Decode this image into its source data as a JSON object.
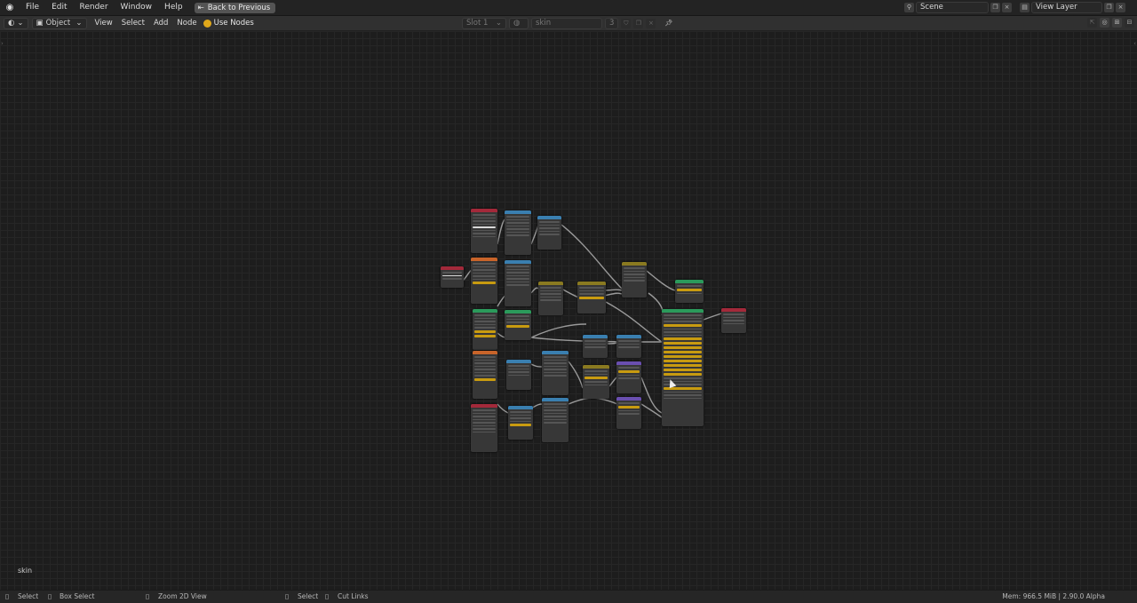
{
  "topbar": {
    "menus": [
      "File",
      "Edit",
      "Render",
      "Window",
      "Help"
    ],
    "back_label": "Back to Previous",
    "scene": "Scene",
    "view_layer": "View Layer"
  },
  "editor_header": {
    "object_mode": "Object",
    "menus": [
      "View",
      "Select",
      "Add",
      "Node"
    ],
    "use_nodes": "Use Nodes",
    "slot": "Slot 1",
    "material": "skin",
    "users": "3"
  },
  "canvas": {
    "material_label": "skin"
  },
  "statusbar": {
    "select": "Select",
    "box_select": "Box Select",
    "zoom": "Zoom 2D View",
    "select2": "Select",
    "cut_links": "Cut Links",
    "mem": "Mem: 966.5 MiB | 2.90.0 Alpha"
  },
  "colors": {
    "input": "#a3293a",
    "converter": "#3a7fb0",
    "shader": "#2b9a5b",
    "color": "#8a7a20",
    "vector": "#6a4fb0",
    "texture": "#c8642a",
    "socket_yellow": "#e0b000"
  }
}
